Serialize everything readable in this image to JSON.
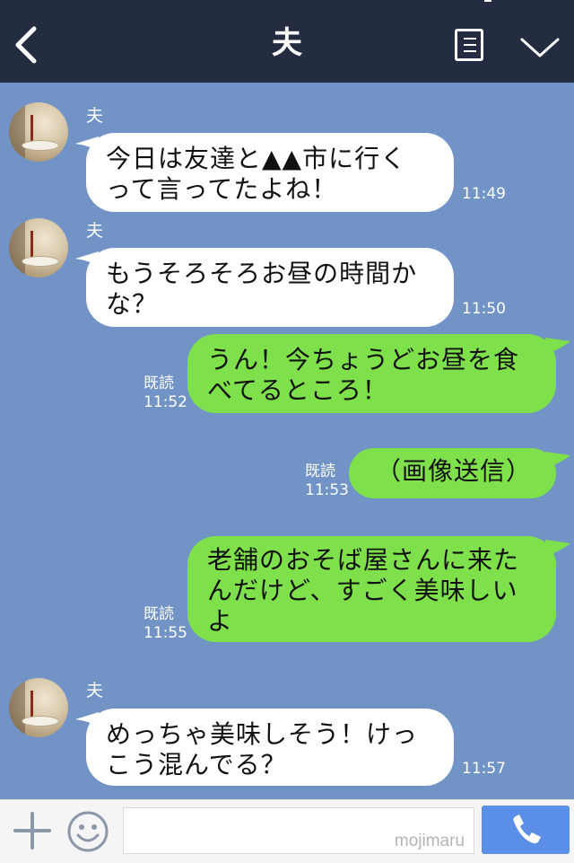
{
  "header": {
    "title": "夫",
    "back_icon": "chevron-left-icon",
    "menu_icon": "list-menu-icon",
    "collapse_icon": "chevron-down-icon"
  },
  "colors": {
    "header_bg": "#232c40",
    "chat_bg": "#7193c6",
    "incoming_bubble": "#ffffff",
    "outgoing_bubble": "#7ee14b",
    "call_button": "#5b8ee6"
  },
  "messages": [
    {
      "direction": "in",
      "sender": "夫",
      "line1": "今日は友達と▲▲市に行く",
      "line2": "って言ってたよね！",
      "time": "11:49"
    },
    {
      "direction": "in",
      "sender": "夫",
      "line1": "もうそろそろお昼の時間か",
      "line2": "な？",
      "time": "11:50"
    },
    {
      "direction": "out",
      "read": "既読",
      "line1": "うん！今ちょうどお昼を食",
      "line2": "べてるところ！",
      "time": "11:52"
    },
    {
      "direction": "out",
      "read": "既読",
      "line1": "（画像送信）",
      "time": "11:53"
    },
    {
      "direction": "out",
      "read": "既読",
      "line1": "老舗のおそば屋さんに来た",
      "line2": "んだけど、すごく美味しい",
      "line3": "よ",
      "time": "11:55"
    },
    {
      "direction": "in",
      "sender": "夫",
      "line1": "めっちゃ美味しそう！けっ",
      "line2": "こう混んでる？",
      "time": "11:57"
    }
  ],
  "footer": {
    "plus_icon": "plus-icon",
    "sticker_icon": "smiley-icon",
    "input_value": "",
    "watermark": "mojimaru",
    "call_icon": "phone-icon"
  }
}
